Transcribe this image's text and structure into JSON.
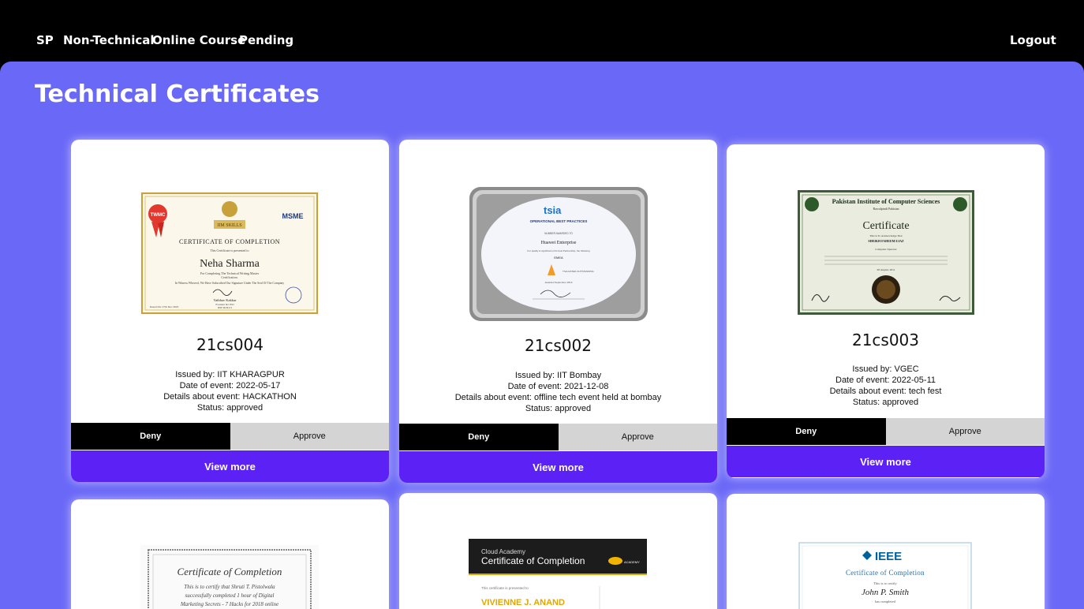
{
  "nav": {
    "links": [
      "SP",
      "Non-Technical",
      "Online Course",
      "Pending"
    ],
    "logout": "Logout"
  },
  "page": {
    "title": "Technical Certificates"
  },
  "labels": {
    "issued_by": "Issued by:",
    "date": "Date of event:",
    "details": "Details about event:",
    "status": "Status:",
    "deny": "Deny",
    "approve": "Approve",
    "view_more": "View more"
  },
  "cards": [
    {
      "id": "21cs004",
      "issued_by": "Issued by: IIT KHARAGPUR",
      "date": "Date of event: 2022-05-17",
      "details": "Details about event: HACKATHON",
      "status": "Status: approved",
      "cert": {
        "tag": "IIM SKILLS",
        "heading": "CERTIFICATE OF COMPLETION",
        "line1": "This Certificate is presented to",
        "name": "Neha Sharma",
        "line2": "For Completing The Technical Writing Master",
        "line3": "Certification.",
        "line4": "In Witness Whereof, We Have Subscribed Our Signature Under The Seal Of The Company",
        "signer": "Vaibhav Kakkar",
        "signer_title": "Founder & CEO",
        "signer_org": "IIM SKILLS",
        "issued": "Issued On: 27th Dec 2023",
        "badge": "TWMC",
        "logo": "MSME"
      }
    },
    {
      "id": "21cs002",
      "issued_by": "Issued by: IIT Bombay",
      "date": "Date of event: 2021-12-08",
      "details": "Details about event: offline tech event held at bombay",
      "status": "Status: approved",
      "cert": {
        "brand": "tsia",
        "heading": "OPERATIONAL BEST PRACTICES",
        "line1": "NUMBER AWARDED TO",
        "name": "Huawei Enterprise",
        "line2": "For quality & significant of its best Partnership, the following",
        "region": "EMEA",
        "award": "TSIA RATED OUTSTANDING",
        "date": "Awarded September 2019"
      }
    },
    {
      "id": "21cs003",
      "issued_by": "Issued by: VGEC",
      "date": "Date of event: 2022-05-11",
      "details": "Details about event: tech fest",
      "status": "Status: approved",
      "cert": {
        "inst": "Pakistan Institute of Computer Sciences",
        "city": "Rawalpindi Pakistan",
        "heading": "Certificate",
        "line1": "This is To Acknowledge That",
        "name": "SHEIKH FAHEEM EJAZ",
        "line2": "Computer Operator",
        "date": "28 August, 2011"
      }
    },
    {
      "cert": {
        "heading": "Certificate of Completion",
        "line1": "This is to certify that Shruti T. Pistolwala",
        "line2": "successfully completed 1 hour of Digital",
        "line3": "Marketing Secrets - 7 Hacks for 2018 online"
      }
    },
    {
      "cert": {
        "brand": "Cloud Academy",
        "heading": "Certificate of Completion",
        "logo": "ACADEMY",
        "line1": "This certificate is presented to",
        "name": "VIVIENNE J. ANAND"
      }
    },
    {
      "cert": {
        "brand": "IEEE",
        "heading": "Certificate of Completion",
        "line1": "This is to certify",
        "name": "John P. Smith",
        "line2": "has completed"
      }
    }
  ],
  "colors": {
    "background": "#6a68f7",
    "nav": "#000000",
    "view_more": "#5b21f5",
    "deny": "#000000",
    "approve": "#d4d4d4"
  }
}
